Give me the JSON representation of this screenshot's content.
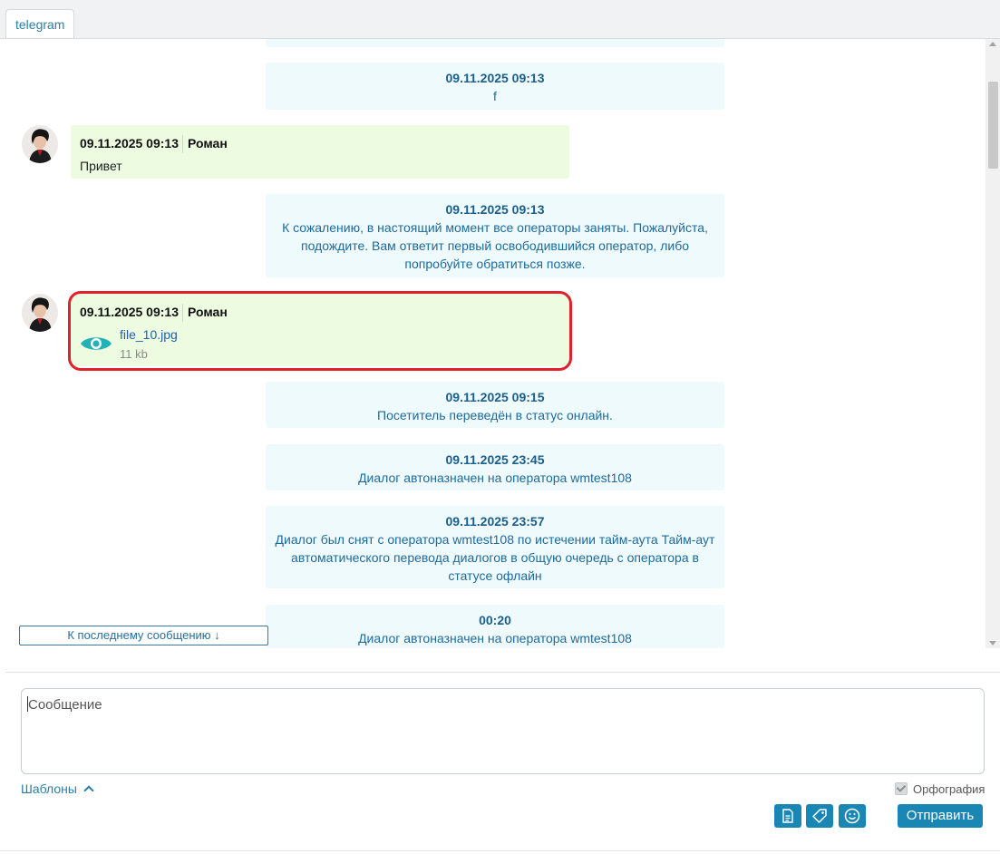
{
  "tabs": [
    {
      "label": "telegram"
    }
  ],
  "messages": {
    "sys1": {
      "time": "09.11.2025 09:13",
      "text": "f"
    },
    "msg1": {
      "time": "09.11.2025 09:13",
      "author": "Роман",
      "text": "Привет"
    },
    "sys2": {
      "time": "09.11.2025 09:13",
      "text": "К сожалению, в настоящий момент все операторы заняты. Пожалуйста, подождите. Вам ответит первый освободившийся оператор, либо попробуйте обратиться позже."
    },
    "msg2": {
      "time": "09.11.2025 09:13",
      "author": "Роман",
      "file_name": "file_10.jpg",
      "file_size": "11 kb"
    },
    "sys3": {
      "time": "09.11.2025 09:15",
      "text": "Посетитель переведён в статус онлайн."
    },
    "sys4": {
      "time": "09.11.2025 23:45",
      "text": "Диалог автоназначен на оператора wmtest108"
    },
    "sys5": {
      "time": "09.11.2025 23:57",
      "text": "Диалог был снят с оператора wmtest108 по истечении тайм-аута Тайм-аут автоматического перевода диалогов в общую очередь с оператора в статусе офлайн"
    },
    "sys6": {
      "time": "00:20",
      "text": "Диалог автоназначен на оператора wmtest108"
    }
  },
  "jump_to_last": "К последнему сообщению ↓",
  "composer": {
    "placeholder": "Сообщение",
    "templates_label": "Шаблоны",
    "spellcheck_label": "Орфография",
    "spellcheck_checked": true,
    "send_label": "Отправить",
    "tools": [
      "document-icon",
      "tag-icon",
      "smile-icon"
    ]
  },
  "colors": {
    "accent": "#1a86b3",
    "operator_bg": "#edfbe1",
    "system_bg": "#effafd",
    "highlight": "#e0202a",
    "eye_icon": "#1fb3b8"
  }
}
